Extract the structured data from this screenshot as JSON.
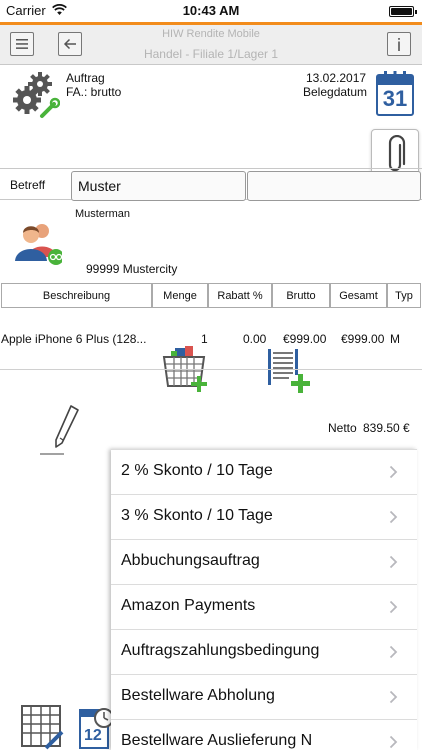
{
  "status": {
    "carrier": "Carrier",
    "time": "10:43 AM"
  },
  "nav": {
    "title": "HIW Rendite Mobile",
    "subtitle": "Handel - Filiale 1/Lager 1"
  },
  "header": {
    "doc_type": "Auftrag",
    "fa_line": "FA.: brutto",
    "date": "13.02.2017",
    "date_label": "Belegdatum",
    "calendar_day": "31"
  },
  "betreff": {
    "label": "Betreff",
    "value": "Muster",
    "value2": ""
  },
  "customer": {
    "name": "Musterman",
    "city_line": "99999 Mustercity"
  },
  "table": {
    "columns": [
      "Beschreibung",
      "Menge",
      "Rabatt %",
      "Brutto",
      "Gesamt",
      "Typ"
    ],
    "rows": [
      {
        "desc": "Apple iPhone 6 Plus (128...",
        "qty": "1",
        "discount": "0.00",
        "gross": "€999.00",
        "total": "€999.00",
        "type": "M"
      }
    ]
  },
  "totals": {
    "netto_label": "Netto",
    "netto_value": "839.50 €"
  },
  "payment_terms": [
    "2 % Skonto / 10 Tage",
    "3 % Skonto / 10 Tage",
    "Abbuchungsauftrag",
    "Amazon Payments",
    "Auftragszahlungsbedingung",
    "Bestellware Abholung",
    "Bestellware Auslieferung N"
  ],
  "colors": {
    "accent": "#f28c1c",
    "icon_blue": "#2f5fa0",
    "icon_green": "#49b33a",
    "nav_bg": "#eeeeee"
  }
}
